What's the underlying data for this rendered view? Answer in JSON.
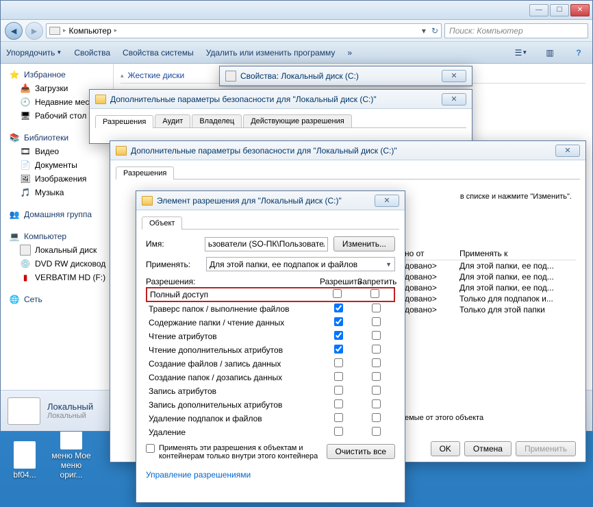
{
  "explorer": {
    "breadcrumb": [
      "Компьютер"
    ],
    "search_placeholder": "Поиск: Компьютер",
    "toolbar": [
      "Упорядочить",
      "Свойства",
      "Свойства системы",
      "Удалить или изменить программу"
    ],
    "hard_disks_label": "Жесткие диски"
  },
  "sidebar": {
    "favorites": {
      "label": "Избранное",
      "items": [
        "Загрузки",
        "Недавние места",
        "Рабочий стол"
      ]
    },
    "libraries": {
      "label": "Библиотеки",
      "items": [
        "Видео",
        "Документы",
        "Изображения",
        "Музыка"
      ]
    },
    "homegroup": {
      "label": "Домашняя группа"
    },
    "computer": {
      "label": "Компьютер",
      "items": [
        "Локальный диск",
        "DVD RW дисковод",
        "VERBATIM HD (F:)"
      ]
    },
    "network": {
      "label": "Сеть"
    }
  },
  "details": {
    "title": "Локальный",
    "sub": "Локальный"
  },
  "desktop_icons": [
    "bf04...",
    "меню Мое меню ориг..."
  ],
  "props_dialog": {
    "title": "Свойства: Локальный диск (C:)"
  },
  "security1": {
    "title": "Дополнительные параметры безопасности для \"Локальный диск (C:)\"",
    "tabs": [
      "Разрешения",
      "Аудит",
      "Владелец",
      "Действующие разрешения"
    ]
  },
  "security2": {
    "title": "Дополнительные параметры безопасности для \"Локальный диск (C:)\"",
    "tabs": [
      "Разрешения"
    ],
    "hint_right": "в списке и нажмите \"Изменить\".",
    "col_headers": [
      "но от",
      "Применять к"
    ],
    "rows": [
      {
        "c1": "довано>",
        "c2": "Для этой папки, ее под..."
      },
      {
        "c1": "довано>",
        "c2": "Для этой папки, ее под..."
      },
      {
        "c1": "довано>",
        "c2": "Для этой папки, ее под..."
      },
      {
        "c1": "довано>",
        "c2": "Только для подпапок и..."
      },
      {
        "c1": "довано>",
        "c2": "Только для этой папки"
      }
    ],
    "inherit_txt": "емые от этого объекта",
    "buttons": {
      "ok": "OK",
      "cancel": "Отмена",
      "apply": "Применить"
    }
  },
  "perm_dialog": {
    "title": "Элемент разрешения для \"Локальный диск (C:)\"",
    "tab": "Объект",
    "name_label": "Имя:",
    "name_value": "ьзователи (SO-ПК\\Пользователи)",
    "change_btn": "Изменить...",
    "apply_label": "Применять:",
    "apply_value": "Для этой папки, ее подпапок и файлов",
    "perm_label": "Разрешения:",
    "allow_label": "Разрешить",
    "deny_label": "Запретить",
    "rows": [
      {
        "name": "Полный доступ",
        "allow": false,
        "deny": false,
        "highlight": true
      },
      {
        "name": "Траверс папок / выполнение файлов",
        "allow": true,
        "deny": false
      },
      {
        "name": "Содержание папки / чтение данных",
        "allow": true,
        "deny": false
      },
      {
        "name": "Чтение атрибутов",
        "allow": true,
        "deny": false
      },
      {
        "name": "Чтение дополнительных атрибутов",
        "allow": true,
        "deny": false
      },
      {
        "name": "Создание файлов / запись данных",
        "allow": false,
        "deny": false
      },
      {
        "name": "Создание папок / дозапись данных",
        "allow": false,
        "deny": false
      },
      {
        "name": "Запись атрибутов",
        "allow": false,
        "deny": false
      },
      {
        "name": "Запись дополнительных атрибутов",
        "allow": false,
        "deny": false
      },
      {
        "name": "Удаление подпапок и файлов",
        "allow": false,
        "deny": false
      },
      {
        "name": "Удаление",
        "allow": false,
        "deny": false
      }
    ],
    "apply_to_containers": "Применять эти разрешения к объектам и контейнерам только внутри этого контейнера",
    "clear_all": "Очистить все",
    "manage_link": "Управление разрешениями"
  }
}
